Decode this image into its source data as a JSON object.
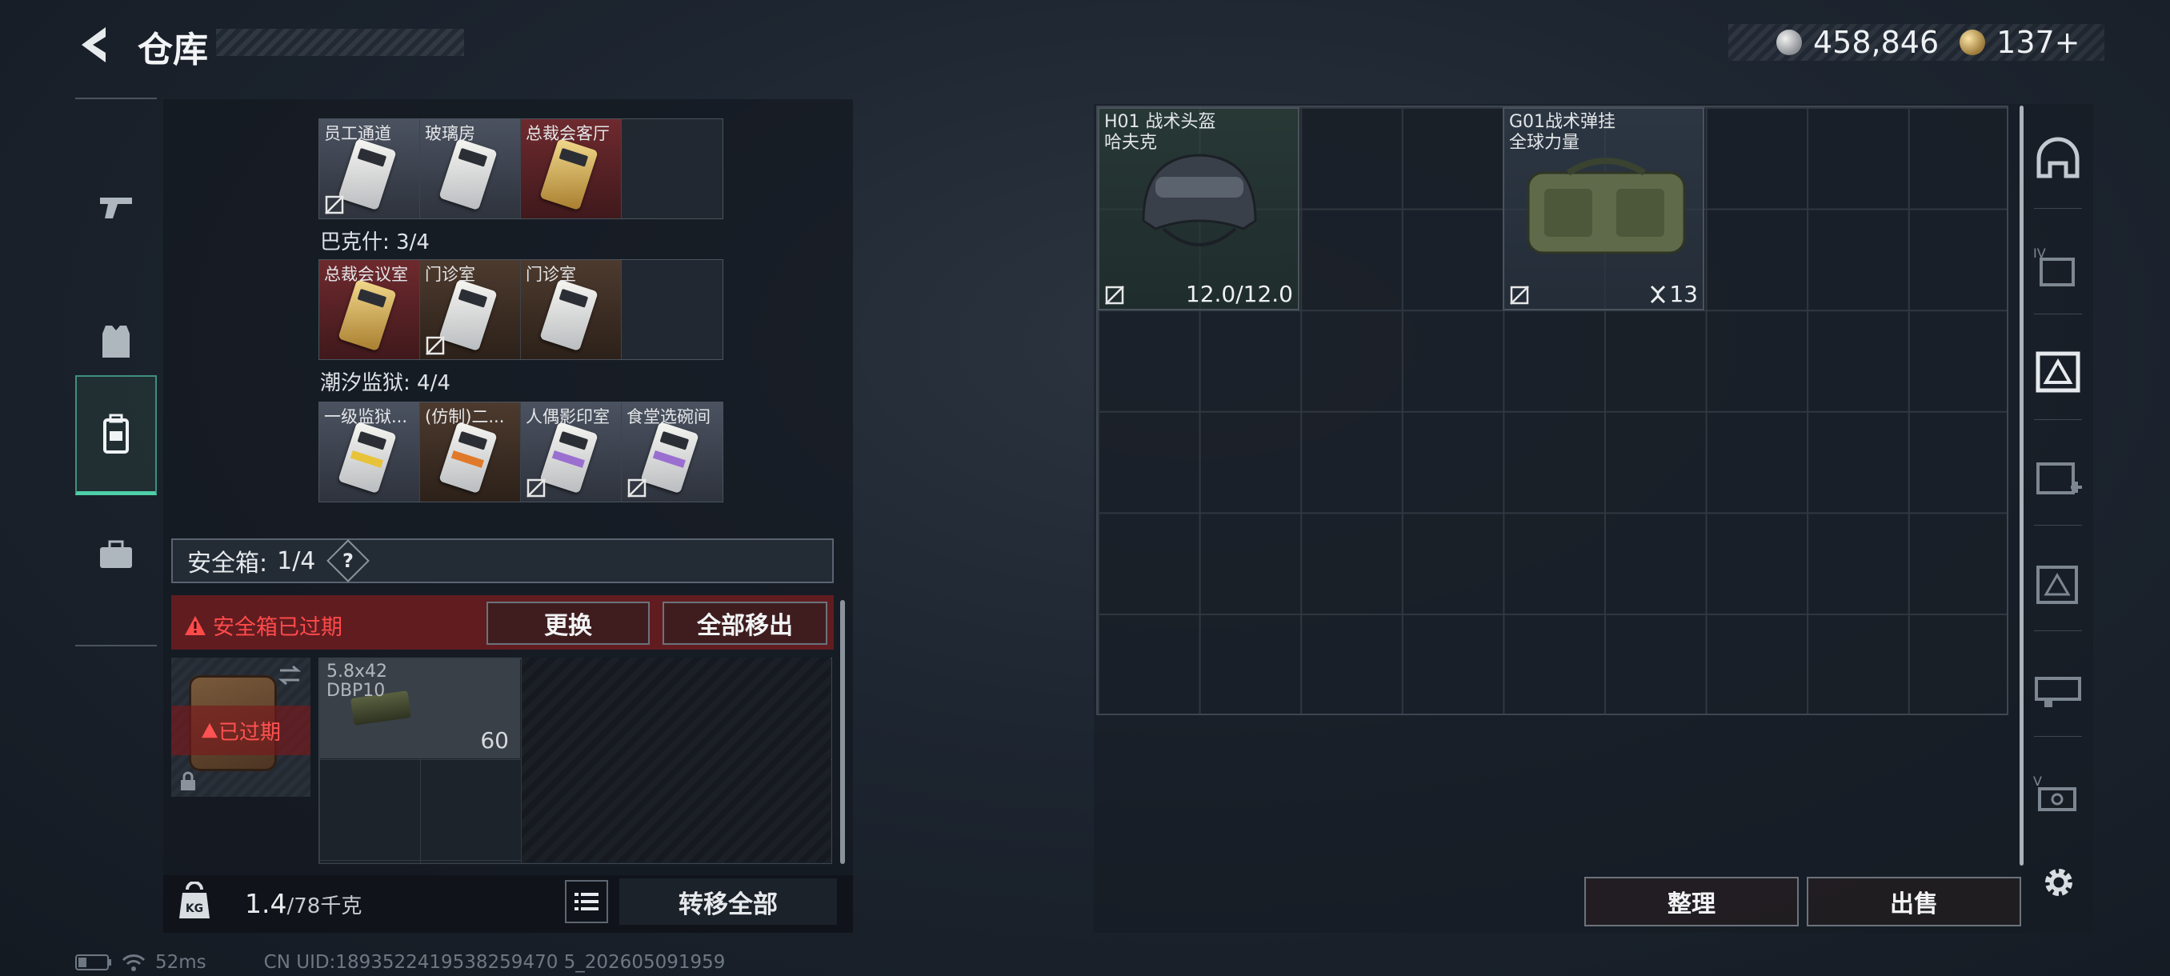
{
  "header": {
    "title": "仓库"
  },
  "currency": {
    "silver": "458,846",
    "gold": "137+"
  },
  "nav": {
    "items": [
      {
        "name": "weapons-tab"
      },
      {
        "name": "armor-tab"
      },
      {
        "name": "backpack-tab",
        "active": true
      },
      {
        "name": "toolbox-tab"
      }
    ]
  },
  "keycards": {
    "top_label": "",
    "group1": {
      "slots": [
        "员工通道",
        "玻璃房",
        "总裁会客厅",
        ""
      ]
    },
    "group2": {
      "label": "巴克什: 3/4",
      "slots": [
        "总裁会议室",
        "门诊室",
        "门诊室",
        ""
      ]
    },
    "group3": {
      "label": "潮汐监狱: 4/4",
      "slots": [
        "一级监狱...",
        "(仿制)二...",
        "人偶影印室",
        "食堂选碗间"
      ]
    }
  },
  "safebox": {
    "label": "安全箱:",
    "count": "1/4",
    "help": "?",
    "expired_warning": "安全箱已过期",
    "replace_button": "更换",
    "move_all_button": "全部移出",
    "expired_overlay": "已过期",
    "ammo": {
      "name_line1": "5.8x42",
      "name_line2": "DBP10",
      "count": "60"
    }
  },
  "footer": {
    "weight_value": "1.4",
    "weight_cap": "/78千克",
    "transfer_all": "转移全部",
    "ping": "52ms",
    "uid": "CN UID:1893522419538259470 5_202605091959"
  },
  "stash": {
    "helmet": {
      "line1": "H01 战术头盔",
      "line2": "哈夫克",
      "durability": "12.0/12.0"
    },
    "bag": {
      "line1": "G01战术弹挂",
      "line2": "全球力量",
      "slots": "13"
    },
    "sort_button": "整理",
    "sell_button": "出售"
  },
  "colors": {
    "accent_teal": "#4ecfa8",
    "warning_red": "#ff4a4a"
  }
}
